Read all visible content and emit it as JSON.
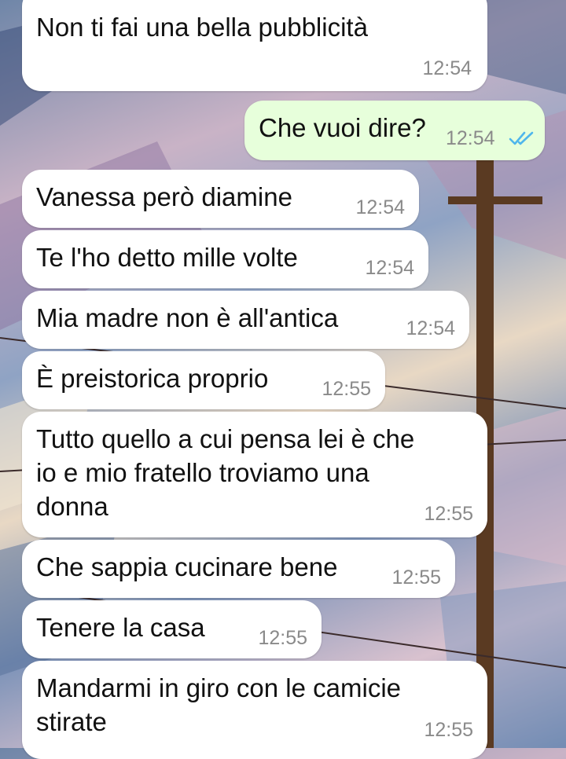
{
  "colors": {
    "incoming_bubble": "#ffffff",
    "outgoing_bubble": "#e7ffdb",
    "text": "#111111",
    "timestamp": "#8a8a8a",
    "read_ticks": "#4fb6ec"
  },
  "messages": [
    {
      "direction": "incoming",
      "text": "Non ti fai una bella pubblicità",
      "time": "12:54"
    },
    {
      "direction": "outgoing",
      "text": "Che vuoi dire?",
      "time": "12:54",
      "status_icon": "double-check-read-icon"
    },
    {
      "direction": "incoming",
      "text": "Vanessa però diamine",
      "time": "12:54"
    },
    {
      "direction": "incoming",
      "text": "Te l'ho detto mille volte",
      "time": "12:54"
    },
    {
      "direction": "incoming",
      "text": "Mia madre non è all'antica",
      "time": "12:54"
    },
    {
      "direction": "incoming",
      "text": "È preistorica proprio",
      "time": "12:55"
    },
    {
      "direction": "incoming",
      "lines": [
        "Tutto quello a cui pensa lei è che",
        "io e mio fratello troviamo una",
        "donna"
      ],
      "time": "12:55"
    },
    {
      "direction": "incoming",
      "text": "Che sappia cucinare bene",
      "time": "12:55"
    },
    {
      "direction": "incoming",
      "text": "Tenere la casa",
      "time": "12:55"
    },
    {
      "direction": "incoming",
      "lines": [
        "Mandarmi in giro con le camicie",
        "stirate"
      ],
      "time": "12:55"
    }
  ]
}
